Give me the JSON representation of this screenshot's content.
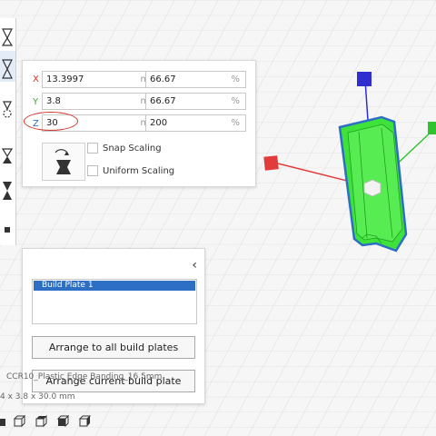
{
  "scale_panel": {
    "rows": [
      {
        "axis": "X",
        "axis_color": "#d0342c",
        "value": "13.3997",
        "unit": "mm",
        "percent": "66.67",
        "percent_unit": "%"
      },
      {
        "axis": "Y",
        "axis_color": "#3aa835",
        "value": "3.8",
        "unit": "mm",
        "percent": "66.67",
        "percent_unit": "%"
      },
      {
        "axis": "Z",
        "axis_color": "#2d6fc4",
        "value": "30",
        "unit": "mm",
        "percent": "200",
        "percent_unit": "%"
      }
    ],
    "snap_scaling_label": "Snap Scaling",
    "uniform_scaling_label": "Uniform Scaling",
    "snap_scaling_checked": false,
    "uniform_scaling_checked": false
  },
  "build_plate_panel": {
    "collapse_glyph": "‹",
    "plates": [
      "Build Plate 1"
    ],
    "arrange_all_label": "Arrange to all build plates",
    "arrange_current_label": "Arrange current build plate"
  },
  "object_info": {
    "name": "CCR10_Plastic Edge Banding_16.5mm",
    "dimensions": "4 x 3.8 x 30.0 mm"
  },
  "colors": {
    "accent": "#2d6fc4",
    "model_green": "#3ee23a",
    "handle_red": "#e23b3b",
    "handle_blue": "#2f2fd0",
    "handle_green": "#2fc42f",
    "annotation_red": "#d0342c"
  },
  "icons": {
    "tools": [
      "move-tool-icon",
      "scale-tool-icon",
      "rotate-tool-icon",
      "mirror-tool-icon",
      "per-model-settings-icon",
      "support-blocker-icon"
    ],
    "views": [
      "3d-view-icon",
      "front-view-icon",
      "top-view-icon",
      "left-view-icon",
      "right-view-icon"
    ]
  }
}
